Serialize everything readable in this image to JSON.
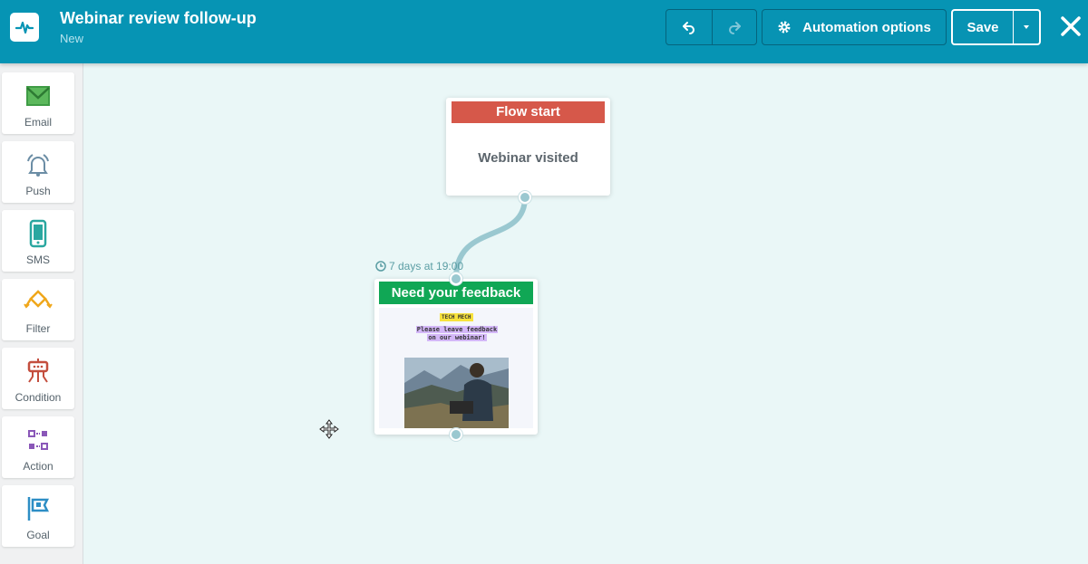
{
  "app": {
    "title": "Webinar review follow-up",
    "subtitle": "New"
  },
  "toolbar": {
    "undo_icon": "undo-icon",
    "redo_icon": "redo-icon",
    "automation_label": "Automation options",
    "automation_icon": "gear-icon",
    "save_label": "Save",
    "save_dropdown_icon": "caret-down-icon",
    "close_icon": "close-icon"
  },
  "sidebar": {
    "items": [
      {
        "label": "Email",
        "icon": "envelope-icon",
        "color": "#3f9c45"
      },
      {
        "label": "Push",
        "icon": "bell-icon",
        "color": "#6b8da5"
      },
      {
        "label": "SMS",
        "icon": "phone-icon",
        "color": "#2aa7a0"
      },
      {
        "label": "Filter",
        "icon": "filter-icon",
        "color": "#f0a71b"
      },
      {
        "label": "Condition",
        "icon": "condition-icon",
        "color": "#c44e3e"
      },
      {
        "label": "Action",
        "icon": "action-icon",
        "color": "#8a57b8"
      },
      {
        "label": "Goal",
        "icon": "flag-icon",
        "color": "#2d8ec5"
      }
    ]
  },
  "canvas": {
    "flow_start": {
      "header": "Flow start",
      "trigger": "Webinar visited",
      "color": "#d6584a"
    },
    "delay": {
      "label": "7 days at 19:00",
      "icon": "clock-icon"
    },
    "email_node": {
      "header": "Need your feedback",
      "color": "#10a755",
      "preview": {
        "tag": "TECH MECH",
        "message_line1": "Please leave feedback",
        "message_line2": "on our webinar!"
      }
    }
  }
}
